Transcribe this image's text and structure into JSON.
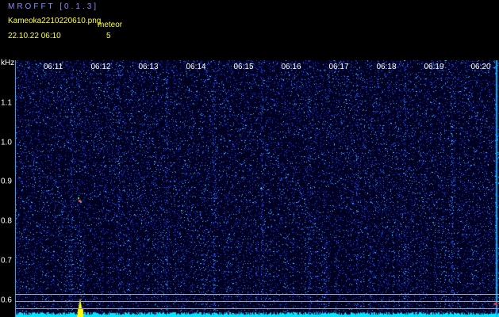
{
  "header": {
    "app_title": "MROFFT [0.1.3]",
    "file_name": "Kameoka2210220610.png",
    "meteor_label": "meteor",
    "date_time": "22.10.22 06:10",
    "meteor_count": "5"
  },
  "axes": {
    "y_unit": "kHz",
    "y_ticks": [
      "1.1",
      "1.0",
      "0.9",
      "0.8",
      "0.7",
      "0.6"
    ],
    "time_ticks": [
      "06:11",
      "06:12",
      "06:13",
      "06:14",
      "06:15",
      "06:16",
      "06:17",
      "06:18",
      "06:19",
      "06:20"
    ]
  },
  "colors": {
    "background": "#000000",
    "plot_bg": "#000021",
    "title": "#8c8cff",
    "info_text": "#ffff40",
    "axis": "#00b4ff",
    "noise_floor": "#00e6ff",
    "peak": "#ffff00"
  }
}
